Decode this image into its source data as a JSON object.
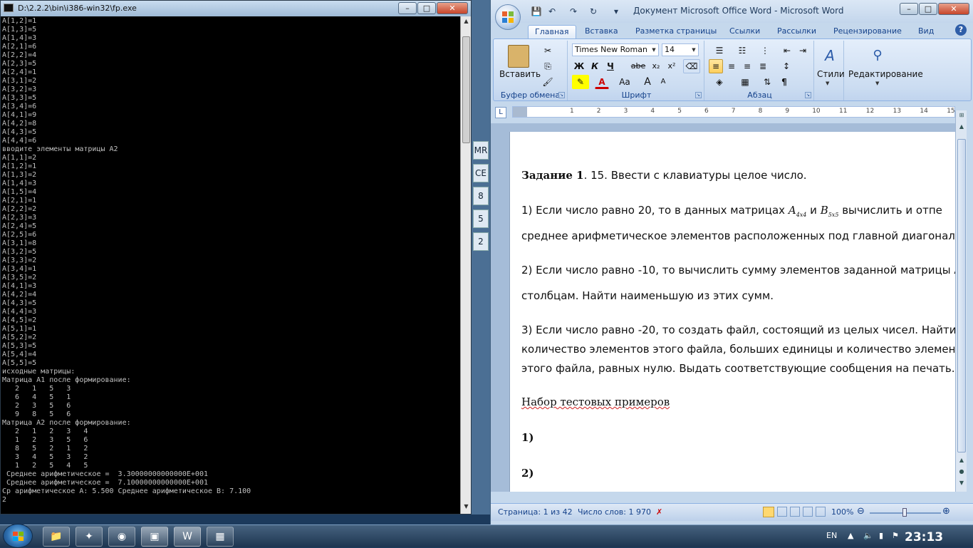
{
  "console": {
    "title": "D:\\2.2.2\\bin\\i386-win32\\fp.exe",
    "buttons": {
      "min": "–",
      "max": "□",
      "close": "✕"
    },
    "lines": [
      "A[1,2]=1",
      "A[1,3]=5",
      "A[1,4]=3",
      "A[2,1]=6",
      "A[2,2]=4",
      "A[2,3]=5",
      "A[2,4]=1",
      "A[3,1]=2",
      "A[3,2]=3",
      "A[3,3]=5",
      "A[3,4]=6",
      "A[4,1]=9",
      "A[4,2]=8",
      "A[4,3]=5",
      "A[4,4]=6",
      "вводите элементы матрицы A2",
      "A[1,1]=2",
      "A[1,2]=1",
      "A[1,3]=2",
      "A[1,4]=3",
      "A[1,5]=4",
      "A[2,1]=1",
      "A[2,2]=2",
      "A[2,3]=3",
      "A[2,4]=5",
      "A[2,5]=6",
      "A[3,1]=8",
      "A[3,2]=5",
      "A[3,3]=2",
      "A[3,4]=1",
      "A[3,5]=2",
      "A[4,1]=3",
      "A[4,2]=4",
      "A[4,3]=5",
      "A[4,4]=3",
      "A[4,5]=2",
      "A[5,1]=1",
      "A[5,2]=2",
      "A[5,3]=5",
      "A[5,4]=4",
      "A[5,5]=5",
      "исходные матрицы:",
      "Матрица A1 после формирование:",
      "   2   1   5   3",
      "   6   4   5   1",
      "   2   3   5   6",
      "   9   8   5   6",
      "Матрица A2 после формирование:",
      "   2   1   2   3   4",
      "   1   2   3   5   6",
      "   8   5   2   1   2",
      "   3   4   5   3   2",
      "   1   2   5   4   5",
      " Среднее арифметическое =  3.30000000000000E+001",
      " Среднее арифметическое =  7.10000000000000E+001",
      "Ср арифметическое A: 5.500 Среднее арифметическое B: 7.100",
      "2"
    ]
  },
  "strip": {
    "items": [
      "MR",
      "CE",
      "8",
      "5",
      "2"
    ]
  },
  "word": {
    "title": "Документ Microsoft Office Word - Microsoft Word",
    "buttons": {
      "min": "–",
      "max": "□",
      "close": "✕"
    },
    "tabs": [
      "Главная",
      "Вставка",
      "Разметка страницы",
      "Ссылки",
      "Рассылки",
      "Рецензирование",
      "Вид"
    ],
    "help": "?",
    "ribbon": {
      "clipboard": {
        "label": "Буфер обмена",
        "paste": "Вставить"
      },
      "font": {
        "label": "Шрифт",
        "name": "Times New Roman",
        "size": "14",
        "bold": "Ж",
        "italic": "К",
        "underline": "Ч",
        "strike": "abe",
        "sub": "x₂",
        "sup": "x²",
        "case": "Aa",
        "grow": "A",
        "shrink": "A"
      },
      "paragraph": {
        "label": "Абзац"
      },
      "styles": {
        "label": "Стили"
      },
      "editing": {
        "label": "Редактирование"
      }
    },
    "ruler_numbers": [
      "1",
      "2",
      "1",
      "2",
      "3",
      "4",
      "5",
      "6",
      "7",
      "8",
      "9",
      "10",
      "11",
      "12",
      "13",
      "14",
      "15"
    ],
    "doc": {
      "task_bold": "Задание 1",
      "task_rest": ". 15. Ввести с клавиатуры целое число.",
      "p1a_pre": "1)  Если  число  равно  20,  то  в  данных  матрицах ",
      "p1a_mid": " и ",
      "p1a_post": " вычислить и отпе",
      "matrixA": "A",
      "matrixA_sub": "4x4",
      "matrixB": "B",
      "matrixB_sub": "5x5",
      "p1b": "среднее арифметическое элементов расположенных под главной диагонал",
      "p2a": "2) Если число равно -10, то вычислить сумму элементов заданной матрицы  A",
      "p2b": "столбцам. Найти наименьшую из этих сумм.",
      "p3a": "3) Если число равно -20, то создать файл, состоящий из целых чисел. Найти",
      "p3b": "количество элементов этого файла, больших единицы и количество элемент",
      "p3c": "этого файла, равных нулю. Выдать соответствующие сообщения на печать.",
      "tests": "Набор тестовых примеров",
      "t1": "1)",
      "t2": "2)"
    },
    "status": {
      "page": "Страница: 1 из 42",
      "words": "Число слов: 1 970",
      "zoom": "100%"
    }
  },
  "taskbar": {
    "lang": "EN",
    "clock": "23:13"
  },
  "colors": {
    "console_bg": "#000000",
    "console_text": "#c0c0c0",
    "word_accent": "#15428b"
  }
}
